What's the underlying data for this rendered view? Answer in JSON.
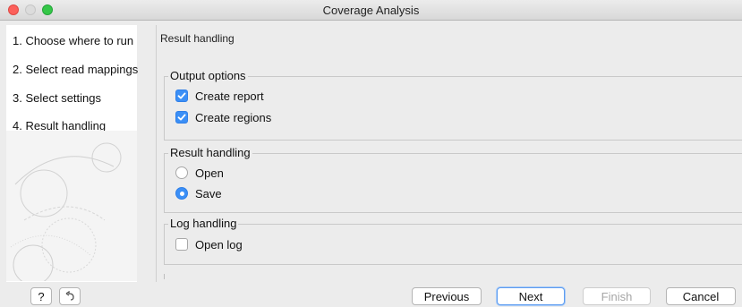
{
  "window": {
    "title": "Coverage Analysis"
  },
  "wizard_steps": [
    "1. Choose where to run",
    "2. Select read mappings",
    "3. Select settings",
    "4. Result handling"
  ],
  "main": {
    "section_title": "Result handling",
    "output_options": {
      "legend": "Output options",
      "create_report": {
        "label": "Create report",
        "checked": true
      },
      "create_regions": {
        "label": "Create regions",
        "checked": true
      }
    },
    "result_handling": {
      "legend": "Result handling",
      "open": {
        "label": "Open",
        "selected": false
      },
      "save": {
        "label": "Save",
        "selected": true
      }
    },
    "log_handling": {
      "legend": "Log handling",
      "open_log": {
        "label": "Open log",
        "checked": false
      }
    }
  },
  "buttons": {
    "help": "?",
    "previous": "Previous",
    "next": "Next",
    "finish": "Finish",
    "cancel": "Cancel"
  },
  "colors": {
    "accent": "#3b8ff6",
    "close": "#fc605b",
    "maximize": "#35c748"
  }
}
